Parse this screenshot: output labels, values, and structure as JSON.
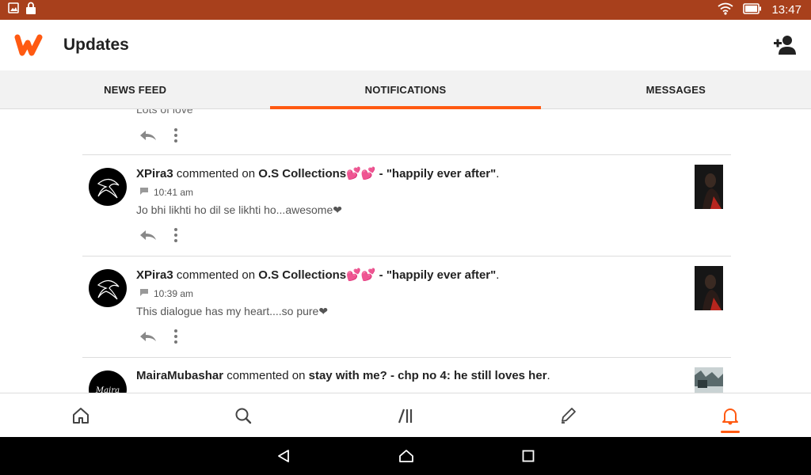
{
  "colors": {
    "status_bg": "#a8401c",
    "accent": "#ff5a12",
    "brand": "#ff5a12"
  },
  "status_bar": {
    "time": "13:47",
    "icons": [
      "image-icon",
      "lock-icon",
      "wifi-icon",
      "battery-icon"
    ]
  },
  "app_bar": {
    "title": "Updates",
    "logo": "wattpad-logo",
    "action_icon": "add-user-icon"
  },
  "tabs": [
    {
      "label": "NEWS FEED",
      "active": false
    },
    {
      "label": "NOTIFICATIONS",
      "active": true
    },
    {
      "label": "MESSAGES",
      "active": false
    }
  ],
  "feed": {
    "partial_item": {
      "comment": "Lots of love"
    },
    "items": [
      {
        "user": "XPira3",
        "action": "commented on",
        "story": "O.S Collections💕💕 - \"happily ever after\"",
        "time": "10:41 am",
        "comment": "Jo bhi likhti ho dil se likhti ho...awesome❤"
      },
      {
        "user": "XPira3",
        "action": "commented on",
        "story": "O.S Collections💕💕 - \"happily ever after\"",
        "time": "10:39 am",
        "comment": "This dialogue has my heart....so pure❤"
      },
      {
        "user": "MairaMubashar",
        "action": "commented on",
        "story": "stay with me? - chp no 4: he still loves her",
        "time": "",
        "comment": ""
      }
    ]
  },
  "bottom_nav": [
    {
      "icon": "home-icon",
      "active": false
    },
    {
      "icon": "search-icon",
      "active": false
    },
    {
      "icon": "library-icon",
      "active": false
    },
    {
      "icon": "write-icon",
      "active": false
    },
    {
      "icon": "notifications-icon",
      "active": true
    }
  ],
  "system_nav": [
    "back-icon",
    "home-circle-icon",
    "recents-icon"
  ]
}
